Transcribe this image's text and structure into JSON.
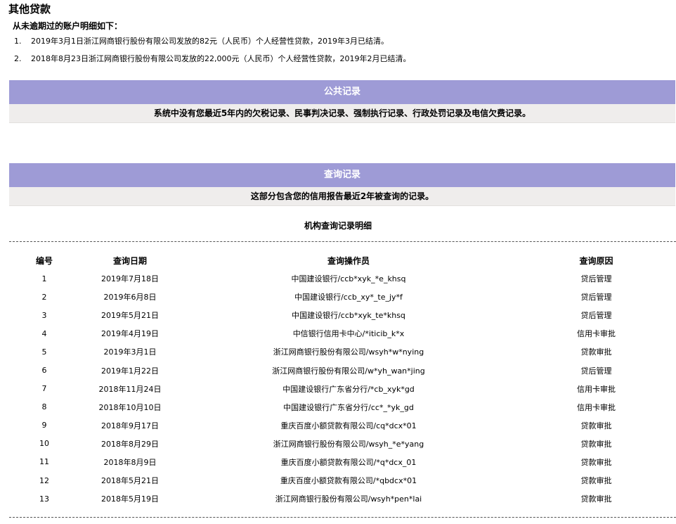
{
  "section_title": "其他贷款",
  "subtitle": "从未逾期过的账户明细如下：",
  "loans": [
    {
      "num": "1.",
      "text": "2019年3月1日浙江网商银行股份有限公司发放的82元（人民币）个人经营性贷款，2019年3月已结清。"
    },
    {
      "num": "2.",
      "text": "2018年8月23日浙江网商银行股份有限公司发放的22,000元（人民币）个人经营性贷款，2019年2月已结清。"
    }
  ],
  "public_record": {
    "title": "公共记录",
    "text": "系统中没有您最近5年内的欠税记录、民事判决记录、强制执行记录、行政处罚记录及电信欠费记录。"
  },
  "query_record": {
    "title": "查询记录",
    "text": "这部分包含您的信用报告最近2年被查询的记录。"
  },
  "detail_title": "机构查询记录明细",
  "table": {
    "headers": [
      "编号",
      "查询日期",
      "查询操作员",
      "查询原因"
    ],
    "rows": [
      [
        "1",
        "2019年7月18日",
        "中国建设银行/ccb*xyk_*e_khsq",
        "贷后管理"
      ],
      [
        "2",
        "2019年6月8日",
        "中国建设银行/ccb_xy*_te_jy*f",
        "贷后管理"
      ],
      [
        "3",
        "2019年5月21日",
        "中国建设银行/ccb*xyk_te*khsq",
        "贷后管理"
      ],
      [
        "4",
        "2019年4月19日",
        "中信银行信用卡中心/*iticib_k*x",
        "信用卡审批"
      ],
      [
        "5",
        "2019年3月1日",
        "浙江网商银行股份有限公司/wsyh*w*nying",
        "贷款审批"
      ],
      [
        "6",
        "2019年1月22日",
        "浙江网商银行股份有限公司/w*yh_wan*jing",
        "贷后管理"
      ],
      [
        "7",
        "2018年11月24日",
        "中国建设银行广东省分行/*cb_xyk*gd",
        "信用卡审批"
      ],
      [
        "8",
        "2018年10月10日",
        "中国建设银行广东省分行/cc*_*yk_gd",
        "信用卡审批"
      ],
      [
        "9",
        "2018年9月17日",
        "重庆百度小额贷款有限公司/cq*dcx*01",
        "贷款审批"
      ],
      [
        "10",
        "2018年8月29日",
        "浙江网商银行股份有限公司/wsyh_*e*yang",
        "贷款审批"
      ],
      [
        "11",
        "2018年8月9日",
        "重庆百度小额贷款有限公司/*q*dcx_01",
        "贷款审批"
      ],
      [
        "12",
        "2018年5月21日",
        "重庆百度小额贷款有限公司/*qbdcx*01",
        "贷款审批"
      ],
      [
        "13",
        "2018年5月19日",
        "浙江网商银行股份有限公司/wsyh*pen*lai",
        "贷款审批"
      ]
    ]
  },
  "colors": {
    "band_header": "#9e9bd6",
    "band_body": "#efedec"
  }
}
